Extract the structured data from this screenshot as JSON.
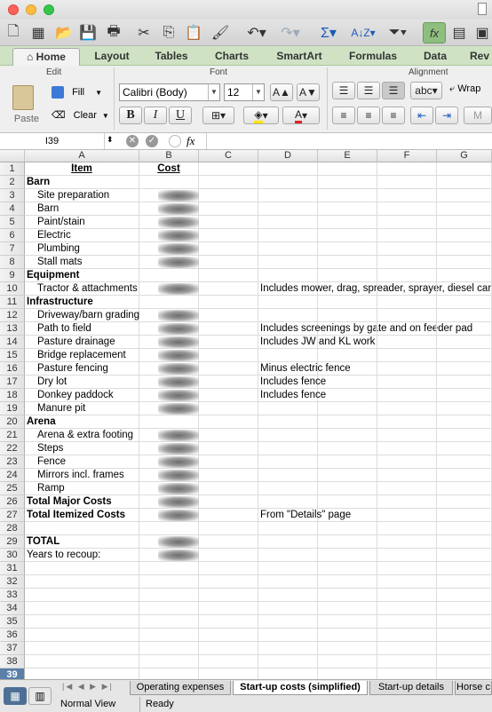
{
  "ribbon": {
    "tabs": [
      "Home",
      "Layout",
      "Tables",
      "Charts",
      "SmartArt",
      "Formulas",
      "Data",
      "Rev"
    ],
    "groups": {
      "edit": "Edit",
      "font": "Font",
      "alignment": "Alignment"
    },
    "paste": "Paste",
    "fill": "Fill",
    "clear": "Clear",
    "font_name": "Calibri (Body)",
    "font_size": "12",
    "bold": "B",
    "italic": "I",
    "underline": "U",
    "wrap": "Wrap",
    "abc": "abc"
  },
  "formula_bar": {
    "cell_ref": "I39",
    "fx": "fx",
    "value": ""
  },
  "columns": [
    "A",
    "B",
    "C",
    "D",
    "E",
    "F",
    "G"
  ],
  "rows": [
    {
      "n": "1",
      "a": "Item",
      "b": "Cost",
      "d": "",
      "style": "header"
    },
    {
      "n": "2",
      "a": "Barn",
      "style": "section"
    },
    {
      "n": "3",
      "a": "Site preparation",
      "blur": true,
      "style": "item"
    },
    {
      "n": "4",
      "a": "Barn",
      "blur": true,
      "style": "item"
    },
    {
      "n": "5",
      "a": "Paint/stain",
      "blur": true,
      "style": "item"
    },
    {
      "n": "6",
      "a": "Electric",
      "blur": true,
      "style": "item"
    },
    {
      "n": "7",
      "a": "Plumbing",
      "blur": true,
      "style": "item"
    },
    {
      "n": "8",
      "a": "Stall mats",
      "blur": true,
      "style": "item"
    },
    {
      "n": "9",
      "a": "Equipment",
      "style": "section"
    },
    {
      "n": "10",
      "a": "Tractor & attachments",
      "blur": true,
      "d": "Includes mower, drag, spreader, sprayer, diesel can",
      "style": "item"
    },
    {
      "n": "11",
      "a": "Infrastructure",
      "style": "section"
    },
    {
      "n": "12",
      "a": "Driveway/barn grading",
      "blur": true,
      "style": "item"
    },
    {
      "n": "13",
      "a": "Path to field",
      "blur": true,
      "d": "Includes screenings by gate and on feeder pad",
      "style": "item"
    },
    {
      "n": "14",
      "a": "Pasture drainage",
      "blur": true,
      "d": "Includes JW and KL work",
      "style": "item"
    },
    {
      "n": "15",
      "a": "Bridge replacement",
      "blur": true,
      "style": "item"
    },
    {
      "n": "16",
      "a": "Pasture fencing",
      "blur": true,
      "d": "Minus electric fence",
      "style": "item"
    },
    {
      "n": "17",
      "a": "Dry lot",
      "blur": true,
      "d": "Includes fence",
      "style": "item"
    },
    {
      "n": "18",
      "a": "Donkey paddock",
      "blur": true,
      "d": "Includes fence",
      "style": "item"
    },
    {
      "n": "19",
      "a": "Manure pit",
      "blur": true,
      "style": "item"
    },
    {
      "n": "20",
      "a": "Arena",
      "style": "section"
    },
    {
      "n": "21",
      "a": "Arena & extra footing",
      "blur": true,
      "style": "item"
    },
    {
      "n": "22",
      "a": "Steps",
      "blur": true,
      "style": "item"
    },
    {
      "n": "23",
      "a": "Fence",
      "blur": true,
      "style": "item"
    },
    {
      "n": "24",
      "a": "Mirrors incl. frames",
      "blur": true,
      "style": "item"
    },
    {
      "n": "25",
      "a": "Ramp",
      "blur": true,
      "style": "item"
    },
    {
      "n": "26",
      "a": "Total Major Costs",
      "blur": true,
      "style": "section"
    },
    {
      "n": "27",
      "a": "Total Itemized Costs",
      "blur": true,
      "d": "From \"Details\" page",
      "style": "section"
    },
    {
      "n": "28",
      "a": "",
      "style": "plain"
    },
    {
      "n": "29",
      "a": "TOTAL",
      "blur": true,
      "style": "section"
    },
    {
      "n": "30",
      "a": "Years to recoup:",
      "blur": true,
      "style": "plain"
    },
    {
      "n": "31",
      "a": "",
      "style": "plain"
    },
    {
      "n": "32",
      "a": "",
      "style": "plain"
    },
    {
      "n": "33",
      "a": "",
      "style": "plain"
    },
    {
      "n": "34",
      "a": "",
      "style": "plain"
    },
    {
      "n": "35",
      "a": "",
      "style": "plain"
    },
    {
      "n": "36",
      "a": "",
      "style": "plain"
    },
    {
      "n": "37",
      "a": "",
      "style": "plain"
    },
    {
      "n": "38",
      "a": "",
      "style": "plain"
    },
    {
      "n": "39",
      "a": "",
      "style": "plain"
    }
  ],
  "sheet_tabs": [
    {
      "label": "Operating expenses",
      "active": false
    },
    {
      "label": "Start-up costs (simplified)",
      "active": true
    },
    {
      "label": "Start-up details",
      "active": false
    },
    {
      "label": "Horse c",
      "active": false
    }
  ],
  "status": {
    "view": "Normal View",
    "state": "Ready"
  },
  "colors": {
    "ribbon_tab_bar": "#cfe3c4",
    "selected_row_header": "#5a7fa8"
  }
}
